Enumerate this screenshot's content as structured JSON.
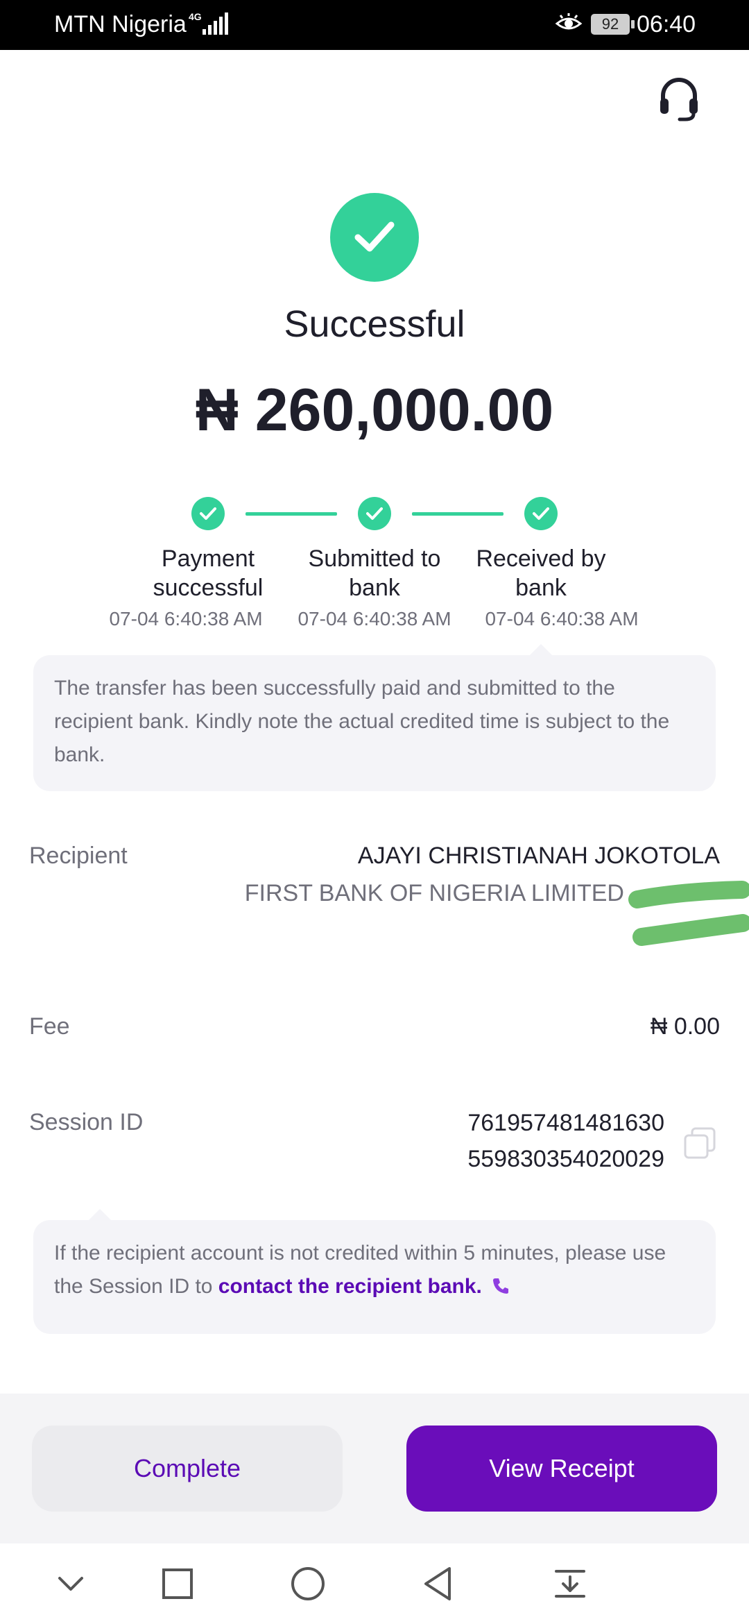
{
  "status_bar": {
    "carrier": "MTN Nigeria",
    "network": "4G",
    "battery": "92",
    "time": "06:40"
  },
  "header": {
    "status": "Successful",
    "amount": "₦ 260,000.00",
    "success_color": "#33d199"
  },
  "steps": [
    {
      "label_line1": "Payment",
      "label_line2": "successful",
      "time": "07-04 6:40:38 AM"
    },
    {
      "label_line1": "Submitted to",
      "label_line2": "bank",
      "time": "07-04 6:40:38 AM"
    },
    {
      "label_line1": "Received by",
      "label_line2": "bank",
      "time": "07-04 6:40:38 AM"
    }
  ],
  "transfer_note": "The transfer has been successfully paid and submitted to the recipient bank. Kindly note the actual credited time is subject to the bank.",
  "details": {
    "recipient_label": "Recipient",
    "recipient_name": "AJAYI CHRISTIANAH JOKOTOLA",
    "recipient_bank": "FIRST BANK OF NIGERIA LIMITED",
    "fee_label": "Fee",
    "fee_value": "₦ 0.00",
    "session_label": "Session ID",
    "session_line1": "761957481481630",
    "session_line2": "559830354020029"
  },
  "help_note": {
    "text": "If the recipient account is not credited within 5 minutes, please use the Session ID to ",
    "link": "contact the recipient bank."
  },
  "actions": {
    "complete_label": "Complete",
    "receipt_label": "View Receipt",
    "accent_color": "#6a0dba"
  }
}
